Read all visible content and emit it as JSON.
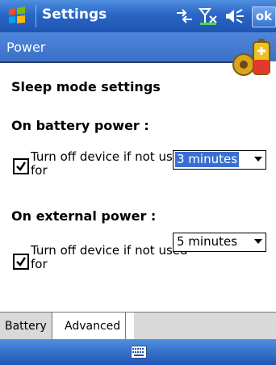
{
  "titlebar": {
    "title": "Settings",
    "ok_label": "ok",
    "start_icon": "windows-flag-icon",
    "status_icons": [
      "connectivity-icon",
      "signal-off-icon",
      "volume-icon"
    ]
  },
  "header": {
    "title": "Power",
    "icon": "battery-power-icon"
  },
  "content": {
    "heading": "Sleep mode settings",
    "battery": {
      "title": "On battery power :",
      "checkbox_label": "Turn off device if not used for",
      "checked": true,
      "dropdown_value": "3 minutes"
    },
    "external": {
      "title": "On external power :",
      "checkbox_label": "Turn off device if not used for",
      "checked": true,
      "dropdown_value": "5 minutes"
    }
  },
  "tabs": [
    {
      "label": "Battery",
      "active": false
    },
    {
      "label": "Advanced",
      "active": true
    }
  ],
  "bottombar": {
    "icon": "keyboard-icon"
  },
  "colors": {
    "titlebar": "#2a66c6",
    "header": "#3b70c8",
    "selection": "#3a6fd1"
  }
}
